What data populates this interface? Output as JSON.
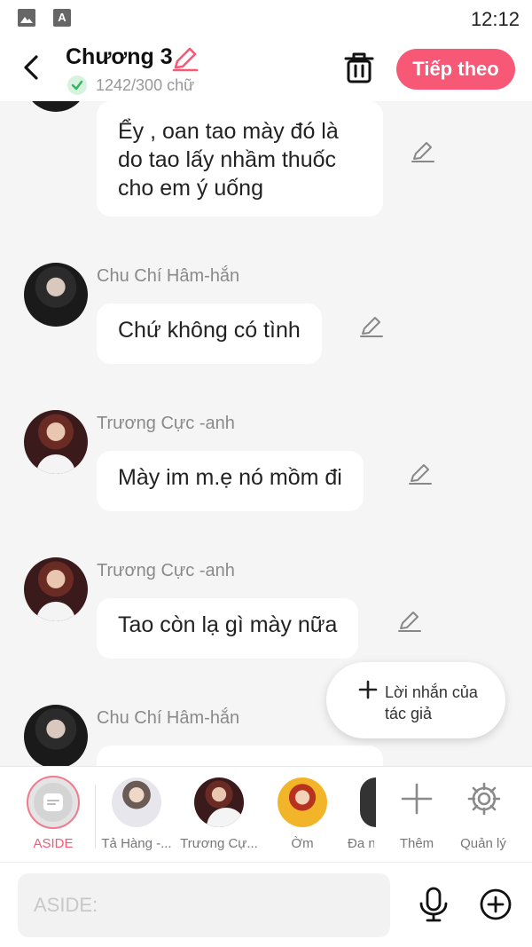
{
  "status_bar": {
    "time": "12:12",
    "icons": [
      "image-icon",
      "font-a-icon"
    ]
  },
  "header": {
    "title": "Chương 3",
    "word_count": "1242/300 chữ",
    "next_label": "Tiếp theo",
    "icons": [
      "back-arrow-icon",
      "pencil-icon",
      "check-circle-icon",
      "trash-icon"
    ]
  },
  "messages": [
    {
      "sender": "",
      "text": "Ểy , oan tao mày đó là do tao lấy nhầm thuốc cho em ý uống"
    },
    {
      "sender": "Chu Chí Hâm-hắn",
      "text": "Chứ không có tình"
    },
    {
      "sender": "Trương Cực -anh",
      "text": "Mày im m.ẹ nó mồm đi"
    },
    {
      "sender": "Trương Cực -anh",
      "text": "Tao còn lạ gì mày nữa"
    },
    {
      "sender": "Chu Chí Hâm-hắn",
      "text": ""
    }
  ],
  "author_note": {
    "label": "Lời nhắn của tác giả"
  },
  "characters": [
    {
      "label": "ASIDE"
    },
    {
      "label": "Tả Hàng -..."
    },
    {
      "label": "Trương Cự..."
    },
    {
      "label": "Ờm"
    },
    {
      "label": "Đa n"
    }
  ],
  "actions": {
    "more": "Thêm",
    "manage": "Quản lý"
  },
  "input": {
    "placeholder": "ASIDE:"
  },
  "colors": {
    "accent": "#f65876",
    "background": "#f5f5f5",
    "bubble": "#ffffff"
  }
}
